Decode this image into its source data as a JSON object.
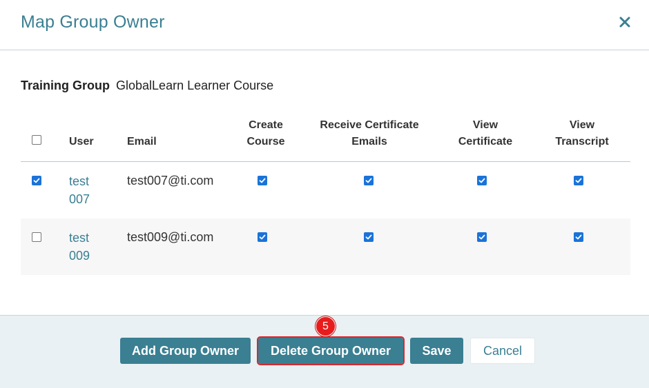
{
  "dialog": {
    "title": "Map Group Owner",
    "close_icon": "close-icon"
  },
  "training_group": {
    "label": "Training Group",
    "value": "GlobalLearn Learner Course"
  },
  "table": {
    "headers": {
      "user": "User",
      "email": "Email",
      "create_course_1": "Create",
      "create_course_2": "Course",
      "receive_cert_1": "Receive Certificate",
      "receive_cert_2": "Emails",
      "view_cert_1": "View",
      "view_cert_2": "Certificate",
      "view_transcript_1": "View",
      "view_transcript_2": "Transcript"
    },
    "select_all_checked": false,
    "rows": [
      {
        "selected": true,
        "user_line1": "test",
        "user_line2": "007",
        "email": "test007@ti.com",
        "create_course": true,
        "receive_certificate_emails": true,
        "view_certificate": true,
        "view_transcript": true
      },
      {
        "selected": false,
        "user_line1": "test",
        "user_line2": "009",
        "email": "test009@ti.com",
        "create_course": true,
        "receive_certificate_emails": true,
        "view_certificate": true,
        "view_transcript": true
      }
    ]
  },
  "footer": {
    "add_label": "Add Group Owner",
    "delete_label": "Delete Group Owner",
    "save_label": "Save",
    "cancel_label": "Cancel"
  },
  "annotation": {
    "step_number": "5"
  },
  "colors": {
    "accent": "#3a7f92",
    "checkbox": "#1a73d9",
    "highlight": "#d7282f",
    "footer_bg": "#e9f1f4"
  }
}
